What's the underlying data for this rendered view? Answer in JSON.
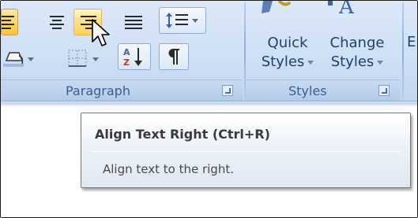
{
  "ribbon": {
    "paragraph_group": {
      "label": "Paragraph",
      "buttons": [
        {
          "name": "align-left",
          "state": "active"
        },
        {
          "name": "center"
        },
        {
          "name": "align-right",
          "state": "hover"
        },
        {
          "name": "justify"
        },
        {
          "name": "line-spacing"
        },
        {
          "name": "shading"
        },
        {
          "name": "borders"
        },
        {
          "name": "sort"
        },
        {
          "name": "show-hide-formatting"
        }
      ]
    },
    "styles_group": {
      "label": "Styles",
      "quick_styles_line1": "Quick",
      "quick_styles_line2": "Styles",
      "change_styles_line1": "Change",
      "change_styles_line2": "Styles",
      "edit_partial": "E"
    }
  },
  "tooltip": {
    "title": "Align Text Right (Ctrl+R)",
    "description": "Align text to the right."
  },
  "colors": {
    "ribbon_bg": "#cfe0f5",
    "active_button": "#ffd466",
    "tooltip_border": "#767676",
    "group_label": "#3b5f8f"
  }
}
